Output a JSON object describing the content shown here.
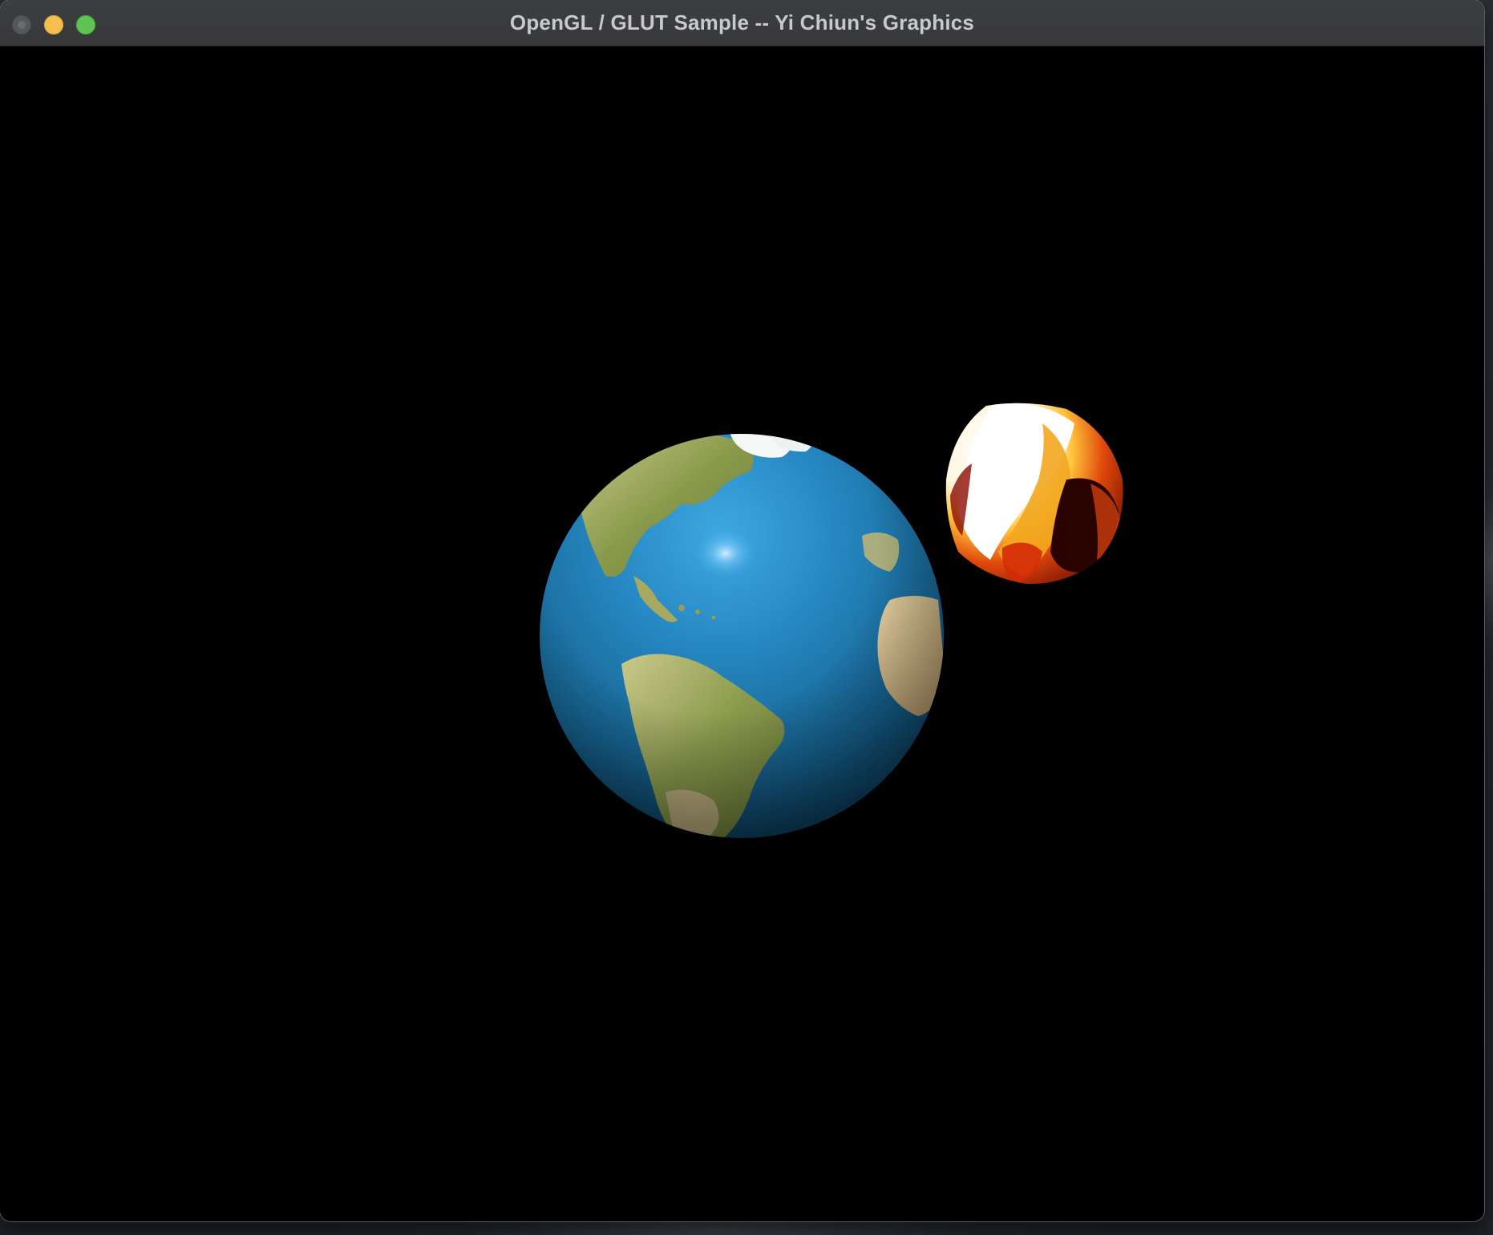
{
  "window": {
    "title": "OpenGL / GLUT Sample -- Yi Chiun's Graphics"
  },
  "titlebar_buttons": [
    {
      "name": "close",
      "color": "#56575a"
    },
    {
      "name": "minimize",
      "color": "#f6bd4f"
    },
    {
      "name": "zoom",
      "color": "#5fc454"
    }
  ],
  "scene": {
    "background_color": "#000000",
    "objects": [
      {
        "name": "earth",
        "texture": "earth-globe"
      },
      {
        "name": "fire-sphere",
        "texture": "molten-fire"
      }
    ]
  }
}
